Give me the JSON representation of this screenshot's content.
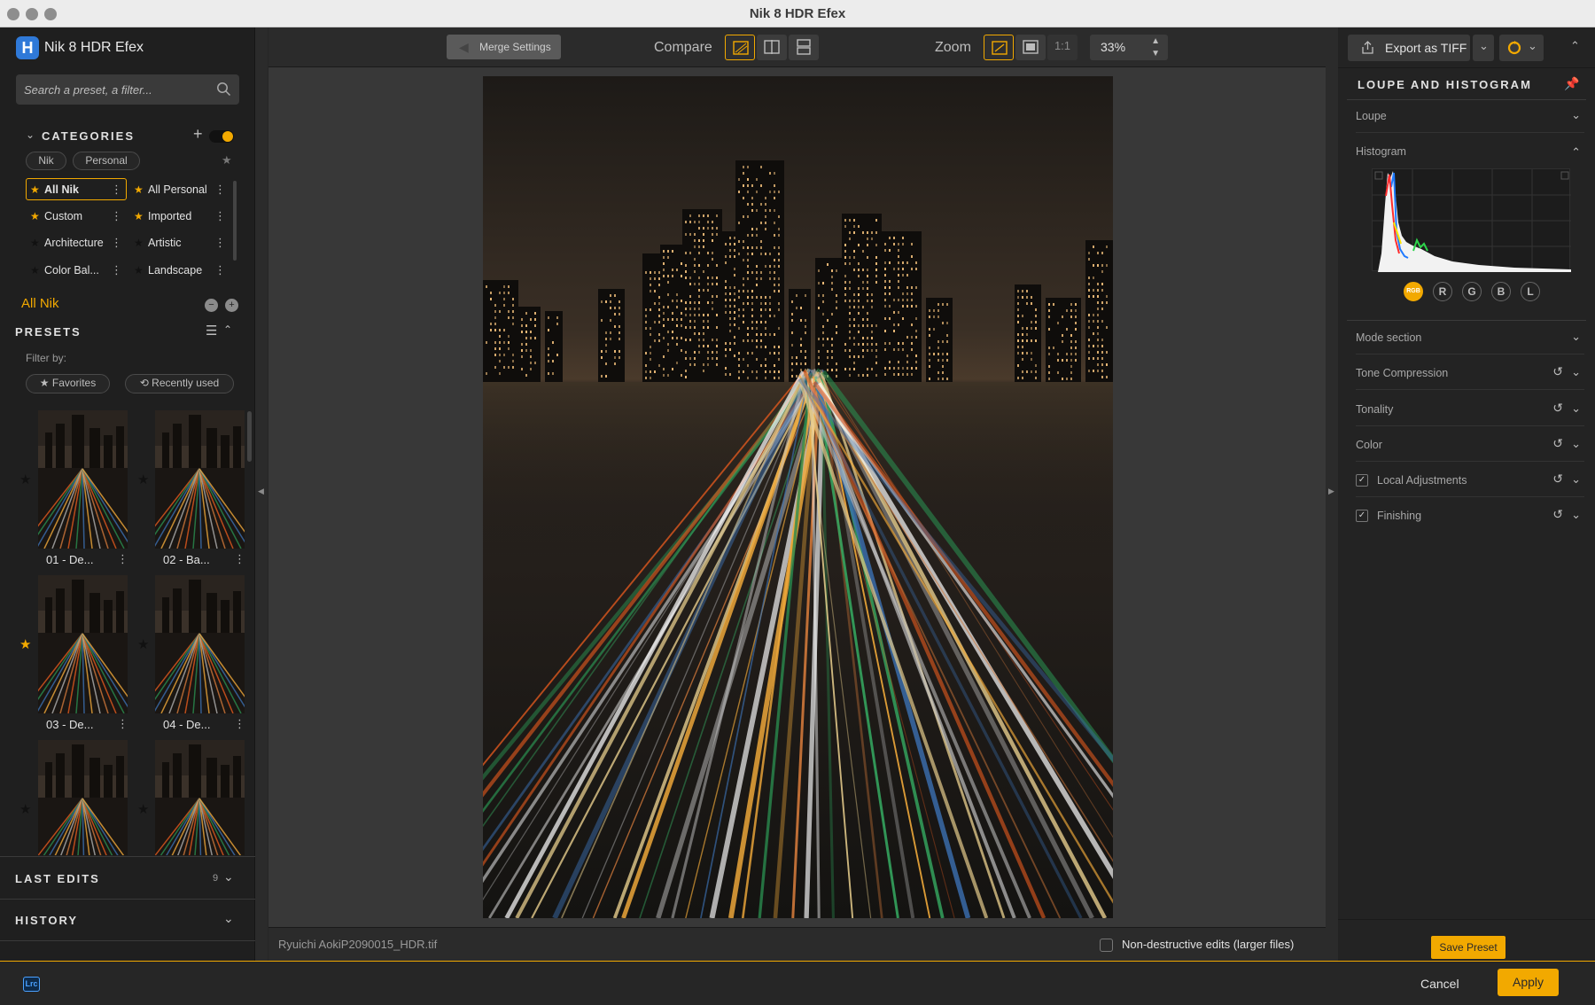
{
  "window": {
    "title": "Nik 8 HDR Efex"
  },
  "app": {
    "logo_letter": "H",
    "name": "Nik 8 HDR Efex"
  },
  "search": {
    "placeholder": "Search a preset, a filter..."
  },
  "categories": {
    "title": "CATEGORIES",
    "tabs": [
      "Nik",
      "Personal"
    ],
    "items": [
      {
        "label": "All Nik",
        "star": "yellow",
        "selected": true
      },
      {
        "label": "All Personal",
        "star": "yellow",
        "selected": false
      },
      {
        "label": "Custom",
        "star": "yellow",
        "selected": false
      },
      {
        "label": "Imported",
        "star": "yellow",
        "selected": false
      },
      {
        "label": "Architecture",
        "star": "black",
        "selected": false
      },
      {
        "label": "Artistic",
        "star": "black",
        "selected": false
      },
      {
        "label": "Color Bal...",
        "star": "black",
        "selected": false
      },
      {
        "label": "Landscape",
        "star": "black",
        "selected": false
      }
    ],
    "current": "All Nik"
  },
  "presets": {
    "title": "PRESETS",
    "filter_label": "Filter by:",
    "filter_favorites": "Favorites",
    "filter_recent": "Recently used",
    "items": [
      {
        "label": "01 - De...",
        "starred": false
      },
      {
        "label": "02 - Ba...",
        "starred": false
      },
      {
        "label": "03 - De...",
        "starred": true
      },
      {
        "label": "04 - De...",
        "starred": false
      },
      {
        "label": "",
        "starred": false
      },
      {
        "label": "",
        "starred": false
      }
    ]
  },
  "last_edits": {
    "title": "LAST EDITS",
    "count": "9"
  },
  "history": {
    "title": "HISTORY"
  },
  "toolbar": {
    "merge_label": "Merge Settings",
    "compare_label": "Compare",
    "zoom_label": "Zoom",
    "zoom_1to1": "1:1",
    "zoom_value": "33%"
  },
  "status": {
    "filename": "Ryuichi AokiP2090015_HDR.tif",
    "nondestructive_label": "Non-destructive edits (larger files)"
  },
  "right": {
    "export_label": "Export as TIFF",
    "section_title": "LOUPE AND HISTOGRAM",
    "loupe": "Loupe",
    "histogram": "Histogram",
    "channels": [
      "RGB",
      "R",
      "G",
      "B",
      "L"
    ],
    "rows": [
      {
        "label": "Mode section",
        "reset": false,
        "checkbox": false
      },
      {
        "label": "Tone Compression",
        "reset": true,
        "checkbox": false
      },
      {
        "label": "Tonality",
        "reset": true,
        "checkbox": false
      },
      {
        "label": "Color",
        "reset": true,
        "checkbox": false
      },
      {
        "label": "Local Adjustments",
        "reset": true,
        "checkbox": true
      },
      {
        "label": "Finishing",
        "reset": true,
        "checkbox": true
      }
    ],
    "save_preset": "Save Preset"
  },
  "bottom": {
    "lrc_badge": "Lrc",
    "cancel": "Cancel",
    "apply": "Apply"
  },
  "colors": {
    "accent": "#f2a900",
    "brand_blue": "#2f79d8"
  },
  "icons": [
    "search-icon",
    "plus-icon",
    "star-icon",
    "more-icon",
    "list-icon",
    "history-icon",
    "export-icon",
    "pin-icon",
    "reset-icon",
    "chevron-down-icon",
    "chevron-up-icon"
  ]
}
